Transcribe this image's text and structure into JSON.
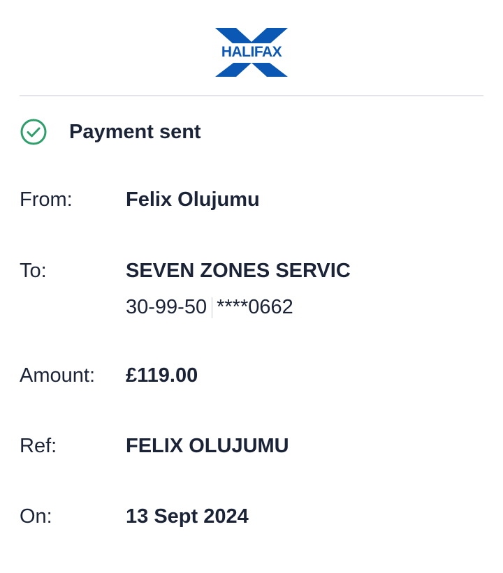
{
  "brand": {
    "name": "HALIFAX",
    "color": "#0a57b4"
  },
  "status": {
    "icon": "check-circle-icon",
    "label": "Payment sent",
    "icon_color": "#2e9e6a"
  },
  "details": {
    "from": {
      "label": "From:",
      "value": "Felix Olujumu"
    },
    "to": {
      "label": "To:",
      "value": "SEVEN ZONES SERVIC",
      "sort_code": "30-99-50",
      "account_number": "****0662"
    },
    "amount": {
      "label": "Amount:",
      "value": "£119.00"
    },
    "ref": {
      "label": "Ref:",
      "value": "FELIX OLUJUMU"
    },
    "on": {
      "label": "On:",
      "value": "13 Sept 2024"
    }
  }
}
